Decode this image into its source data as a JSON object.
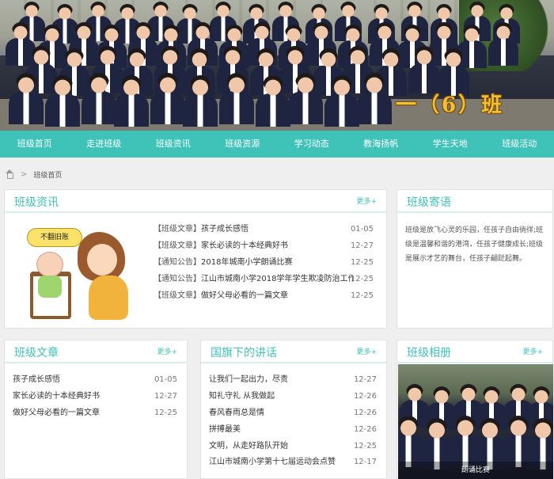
{
  "banner": {
    "title": "一（6）班"
  },
  "nav": [
    "班级首页",
    "走进班级",
    "班级资讯",
    "班级资源",
    "学习动态",
    "教海扬帆",
    "学生天地",
    "班级活动"
  ],
  "breadcrumb": {
    "current": "班级首页"
  },
  "more_label": "更多+",
  "news": {
    "title": "班级资讯",
    "cartoon_text": "不翻旧账",
    "items": [
      {
        "tag": "【班级文章】",
        "text": "孩子成长感悟",
        "date": "01-05"
      },
      {
        "tag": "【班级文章】",
        "text": "家长必读的十本经典好书",
        "date": "12-27"
      },
      {
        "tag": "【通知公告】",
        "text": "2018年城南小学朗诵比赛",
        "date": "12-25"
      },
      {
        "tag": "【通知公告】",
        "text": "江山市城南小学2018学年学生欺凌防治工作...",
        "date": "12-25"
      },
      {
        "tag": "【班级文章】",
        "text": "做好父母必看的一篇文章",
        "date": "12-25"
      }
    ]
  },
  "message": {
    "title": "班级寄语",
    "text": "班级是放飞心灵的乐园，任孩子自由徜徉;班级是温馨和谐的港湾，任孩子健康成长;班级是展示才艺的舞台，任孩子翩跹起舞。"
  },
  "articles": {
    "title": "班级文章",
    "items": [
      {
        "text": "孩子成长感悟",
        "date": "01-05"
      },
      {
        "text": "家长必读的十本经典好书",
        "date": "12-27"
      },
      {
        "text": "做好父母必看的一篇文章",
        "date": "12-25"
      }
    ]
  },
  "speech": {
    "title": "国旗下的讲话",
    "items": [
      {
        "text": "让我们一起出力，尽责",
        "date": "12-27"
      },
      {
        "text": "知礼守礼 从我做起",
        "date": "12-26"
      },
      {
        "text": "春风春雨总是情",
        "date": "12-26"
      },
      {
        "text": "拼搏最美",
        "date": "12-26"
      },
      {
        "text": "文明，从走好路队开始",
        "date": "12-25"
      },
      {
        "text": "江山市城南小学第十七届运动会点赞",
        "date": "12-17"
      }
    ]
  },
  "album": {
    "title": "班级相册",
    "caption": "朗诵比赛"
  }
}
